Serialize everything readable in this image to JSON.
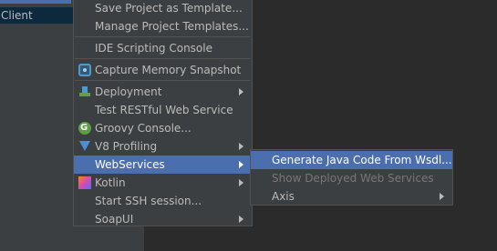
{
  "tree": {
    "selected_item_label": "Client"
  },
  "main_menu": {
    "items": [
      {
        "label": "Save Project as Template...",
        "mnemonic": ""
      },
      {
        "label": "Manage Project Templates..."
      },
      {
        "label": "IDE Scripting Console"
      },
      {
        "label": "Capture Memory Snapshot",
        "icon": "camera-icon"
      },
      {
        "label": "Deployment",
        "icon": "deployment-icon"
      },
      {
        "label": "Test RESTful Web Service"
      },
      {
        "label": "Groovy Console...",
        "icon": "groovy-icon"
      },
      {
        "label": "V8 Profiling",
        "icon": "v8-icon"
      },
      {
        "label": "WebServices"
      },
      {
        "label": "Kotlin",
        "icon": "kotlin-icon"
      },
      {
        "label": "Start SSH session..."
      },
      {
        "label": "SoapUI"
      }
    ]
  },
  "sub_menu": {
    "items": [
      {
        "label": "Generate Java Code From Wsdl..."
      },
      {
        "label": "Show Deployed Web Services"
      },
      {
        "label": "Axis"
      }
    ]
  },
  "colors": {
    "menu_bg": "#3c3f41",
    "selection": "#4b6eaf",
    "text": "#bbbbbb",
    "disabled_text": "#777777",
    "editor_bg": "#2b2b2b"
  }
}
